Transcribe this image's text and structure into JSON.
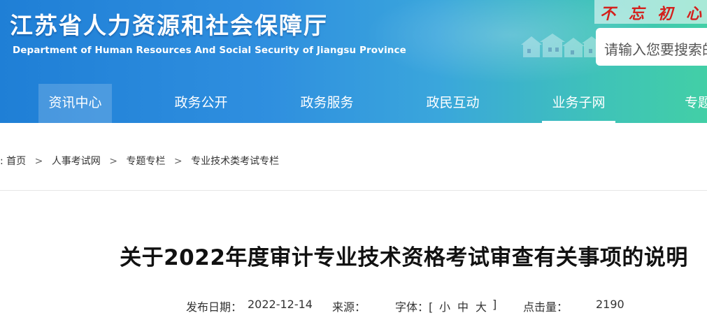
{
  "header": {
    "title": "江苏省人力资源和社会保障厅",
    "subtitle": "Department of Human Resources And Social Security of Jiangsu Province",
    "slogan": "不忘初心",
    "search": {
      "placeholder": "请输入您要搜索的"
    }
  },
  "nav": {
    "items": [
      {
        "label": "资讯中心"
      },
      {
        "label": "政务公开"
      },
      {
        "label": "政务服务"
      },
      {
        "label": "政民互动"
      },
      {
        "label": "业务子网"
      },
      {
        "label": "专题专"
      }
    ]
  },
  "breadcrumb": {
    "lead": ":",
    "items": [
      "首页",
      "人事考试网",
      "专题专栏",
      "专业技术类考试专栏"
    ],
    "separator": ">"
  },
  "article": {
    "title": "关于2022年度审计专业技术资格考试审查有关事项的说明",
    "publish_date_label": "发布日期：",
    "publish_date": "2022-12-14",
    "source_label": "来源：",
    "font_label": "字体：[",
    "font_small": "小",
    "font_medium": "中",
    "font_large": "大",
    "font_close": "]",
    "views_label": "点击量：",
    "views": "2190"
  },
  "colors": {
    "banner_start": "#1f7fd6",
    "banner_end": "#42cfa6",
    "slogan": "#d4201c"
  }
}
